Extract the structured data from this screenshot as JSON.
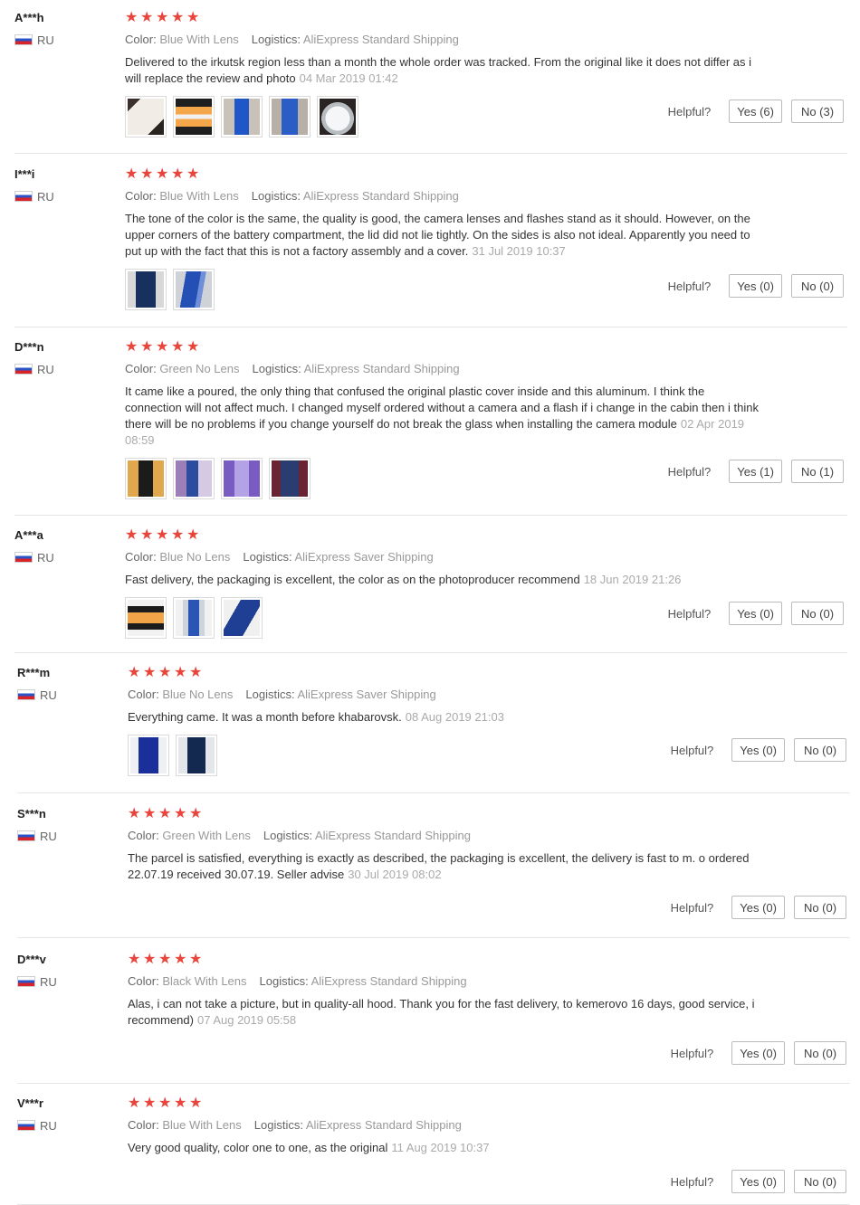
{
  "labels": {
    "color": "Color:",
    "logistics": "Logistics:",
    "helpful": "Helpful?"
  },
  "colors": {
    "star": "#e8453c",
    "divider": "#e6e6e6",
    "date": "#aaaaaa"
  },
  "reviews": [
    {
      "user": "A***h",
      "country": "RU",
      "stars": 5,
      "color": "Blue With Lens",
      "logistics": "AliExpress Standard Shipping",
      "text": "Delivered to the irkutsk region less than a month the whole order was tracked. From the original like it does not differ as i will replace the review and photo",
      "date": "04 Mar 2019 01:42",
      "photos": [
        "box-white",
        "box-orange",
        "phone-blue",
        "phone-blue-back",
        "box-clear"
      ],
      "yes": "Yes (6)",
      "no": "No (3)"
    },
    {
      "user": "I***i",
      "country": "RU",
      "stars": 5,
      "color": "Blue With Lens",
      "logistics": "AliExpress Standard Shipping",
      "text": "The tone of the color is the same, the quality is good, the camera lenses and flashes stand as it should. However, on the upper corners of the battery compartment, the lid did not lie tightly. On the sides is also not ideal. Apparently you need to put up with the fact that this is not a factory assembly and a cover.",
      "date": "31 Jul 2019 10:37",
      "photos": [
        "phone-dark",
        "phone-blue-side"
      ],
      "yes": "Yes (0)",
      "no": "No (0)"
    },
    {
      "user": "D***n",
      "country": "RU",
      "stars": 5,
      "color": "Green No Lens",
      "logistics": "AliExpress Standard Shipping",
      "text": "It came like a poured, the only thing that confused the original plastic cover inside and this aluminum. I think the connection will not affect much. I changed myself ordered without a camera and a flash if i change in the cabin then i think there will be no problems if you change yourself do not break the glass when installing the camera module",
      "date": "02 Apr 2019 08:59",
      "photos": [
        "phone-screen",
        "phone-purple",
        "phone-violet",
        "phone-red"
      ],
      "yes": "Yes (1)",
      "no": "No (1)"
    },
    {
      "user": "A***a",
      "country": "RU",
      "stars": 5,
      "color": "Blue No Lens",
      "logistics": "AliExpress Saver Shipping",
      "text": "Fast delivery, the packaging is excellent, the color as on the photoproducer recommend",
      "date": "18 Jun 2019 21:26",
      "photos": [
        "box-orange-dark",
        "box-clear-phone",
        "phone-blue-angle"
      ],
      "yes": "Yes (0)",
      "no": "No (0)"
    },
    {
      "user": "R***m",
      "country": "RU",
      "stars": 5,
      "color": "Blue No Lens",
      "logistics": "AliExpress Saver Shipping",
      "text": "Everything came. It was a month before khabarovsk.",
      "date": "08 Aug 2019 21:03",
      "photos": [
        "phone-blue-deep",
        "phone-navy"
      ],
      "yes": "Yes (0)",
      "no": "No (0)"
    },
    {
      "user": "S***n",
      "country": "RU",
      "stars": 5,
      "color": "Green With Lens",
      "logistics": "AliExpress Standard Shipping",
      "text": "The parcel is satisfied, everything is exactly as described, the packaging is excellent, the delivery is fast to m. o ordered 22.07.19 received 30.07.19. Seller advise",
      "date": "30 Jul 2019 08:02",
      "photos": [],
      "yes": "Yes (0)",
      "no": "No (0)"
    },
    {
      "user": "D***v",
      "country": "RU",
      "stars": 5,
      "color": "Black With Lens",
      "logistics": "AliExpress Standard Shipping",
      "text": "Alas, i can not take a picture, but in quality-all hood. Thank you for the fast delivery, to kemerovo 16 days, good service, i recommend)",
      "date": "07 Aug 2019 05:58",
      "photos": [],
      "yes": "Yes (0)",
      "no": "No (0)"
    },
    {
      "user": "V***r",
      "country": "RU",
      "stars": 5,
      "color": "Blue With Lens",
      "logistics": "AliExpress Standard Shipping",
      "text": "Very good quality, color one to one, as the original",
      "date": "11 Aug 2019 10:37",
      "photos": [],
      "yes": "Yes (0)",
      "no": "No (0)"
    }
  ]
}
